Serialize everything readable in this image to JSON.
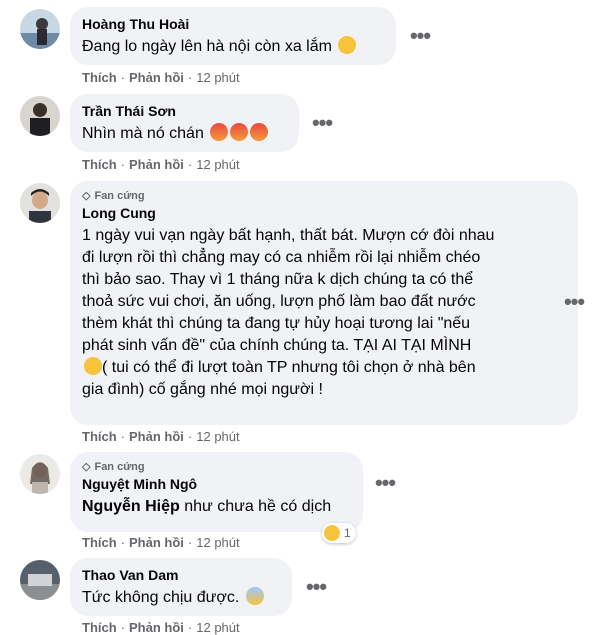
{
  "comments": [
    {
      "author": "Hoàng Thu Hoài",
      "text": "Đang lo ngày lên hà nội còn xa lắm",
      "emoji": "slightly-smiling-face",
      "like": "Thích",
      "reply": "Phản hồi",
      "time": "12 phút"
    },
    {
      "author": "Trần Thái Sơn",
      "text": "Nhìn mà nó chán",
      "emoji": "angry-face x3",
      "like": "Thích",
      "reply": "Phản hồi",
      "time": "12 phút"
    },
    {
      "badge": "Fan cứng",
      "author": "Long Cung",
      "text_lines": [
        "1 ngày vui vạn ngày bất hạnh, thất bát. Mượn cớ đòi nhau",
        "đi lượn rồi thì chẳng may có ca nhiễm rồi lại nhiễm chéo",
        "thì bảo sao. Thay vì 1 tháng nữa k dịch chúng ta có thể",
        "thoả sức vui chơi, ăn uống, lượn phố làm bao đất nước",
        "thèm khát thì chúng ta đang tự hủy hoại tương lai \"nếu",
        "phát sinh vấn đề\" của chính chúng ta. TẠI AI TẠI MÌNH",
        "( tui có thể đi lượt toàn TP nhưng tôi chọn ở nhà bên",
        "gia đình) cố gắng nhé mọi người !"
      ],
      "like": "Thích",
      "reply": "Phản hồi",
      "time": "12 phút"
    },
    {
      "badge": "Fan cứng",
      "author": "Nguyệt Minh Ngô",
      "mention": "Nguyễn Hiệp",
      "text": "như chưa hề có dịch",
      "reaction_count": "1",
      "like": "Thích",
      "reply": "Phản hồi",
      "time": "12 phút"
    },
    {
      "author": "Thao Van Dam",
      "text": "Tức không chịu được.",
      "emoji": "face-screaming-in-fear",
      "like": "Thích",
      "reply": "Phản hồi",
      "time": "12 phút"
    }
  ],
  "more_label": "•••",
  "separator": "·"
}
